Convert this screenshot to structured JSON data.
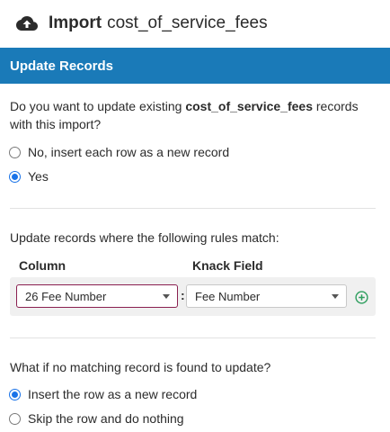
{
  "header": {
    "icon": "cloud-upload-icon",
    "title_strong": "Import",
    "title_object": "cost_of_service_fees"
  },
  "section": {
    "title": "Update Records"
  },
  "update_question": {
    "prefix": "Do you want to update existing ",
    "object": "cost_of_service_fees",
    "suffix": " records with this import?",
    "options": [
      {
        "label": "No, insert each row as a new record",
        "checked": false
      },
      {
        "label": "Yes",
        "checked": true
      }
    ]
  },
  "match_rules": {
    "prompt": "Update records where the following rules match:",
    "column_header": "Column",
    "field_header": "Knack Field",
    "rule": {
      "column_value": "26 Fee Number",
      "separator": ":",
      "field_value": "Fee Number"
    },
    "add_icon": "plus-circle-icon"
  },
  "no_match": {
    "prompt": "What if no matching record is found to update?",
    "options": [
      {
        "label": "Insert the row as a new record",
        "checked": true
      },
      {
        "label": "Skip the row and do nothing",
        "checked": false
      }
    ]
  },
  "colors": {
    "header_bg": "#1a7ab8",
    "radio_checked": "#1a73e8",
    "add_icon": "#2e9e5e",
    "focused_border": "#8a2050"
  }
}
